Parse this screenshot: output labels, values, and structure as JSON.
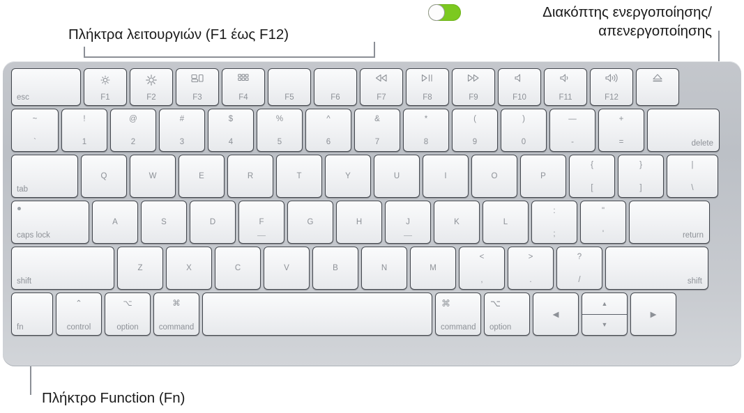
{
  "annotations": {
    "function_keys": "Πλήκτρα λειτουργιών (F1 έως F12)",
    "power_toggle": "Διακόπτης ενεργοποίησης/\nαπενεργοποίησης",
    "fn_key": "Πλήκτρο Function (Fn)"
  },
  "colors": {
    "toggle_on": "#7cc920",
    "toggle_knob": "#fdfdfd",
    "keyboard_body": "#c4c7cc",
    "key_face": "#f2f3f5",
    "key_legend": "#8d9197",
    "annotation_text": "#1a1a1a",
    "leader_line": "#8b8f96"
  },
  "keyboard": {
    "rows": [
      {
        "name": "function-row",
        "keys": [
          {
            "name": "esc",
            "label": "esc",
            "style": "bl"
          },
          {
            "name": "f1",
            "label": "F1",
            "style": "bc",
            "icon": "brightness-down-icon"
          },
          {
            "name": "f2",
            "label": "F2",
            "style": "bc",
            "icon": "brightness-up-icon"
          },
          {
            "name": "f3",
            "label": "F3",
            "style": "bc",
            "icon": "mission-control-icon"
          },
          {
            "name": "f4",
            "label": "F4",
            "style": "bc",
            "icon": "launchpad-icon"
          },
          {
            "name": "f5",
            "label": "F5",
            "style": "bc"
          },
          {
            "name": "f6",
            "label": "F6",
            "style": "bc"
          },
          {
            "name": "f7",
            "label": "F7",
            "style": "bc",
            "icon": "rewind-icon"
          },
          {
            "name": "f8",
            "label": "F8",
            "style": "bc",
            "icon": "play-pause-icon"
          },
          {
            "name": "f9",
            "label": "F9",
            "style": "bc",
            "icon": "fast-forward-icon"
          },
          {
            "name": "f10",
            "label": "F10",
            "style": "bc",
            "icon": "mute-icon"
          },
          {
            "name": "f11",
            "label": "F11",
            "style": "bc",
            "icon": "volume-down-icon"
          },
          {
            "name": "f12",
            "label": "F12",
            "style": "bc",
            "icon": "volume-up-icon"
          },
          {
            "name": "eject",
            "label": "",
            "style": "bc",
            "icon": "eject-icon"
          }
        ]
      },
      {
        "name": "number-row",
        "keys": [
          {
            "name": "grave-tilde",
            "upper": "~",
            "lower": "`"
          },
          {
            "name": "digit-1",
            "upper": "!",
            "lower": "1"
          },
          {
            "name": "digit-2",
            "upper": "@",
            "lower": "2"
          },
          {
            "name": "digit-3",
            "upper": "#",
            "lower": "3"
          },
          {
            "name": "digit-4",
            "upper": "$",
            "lower": "4"
          },
          {
            "name": "digit-5",
            "upper": "%",
            "lower": "5"
          },
          {
            "name": "digit-6",
            "upper": "^",
            "lower": "6"
          },
          {
            "name": "digit-7",
            "upper": "&",
            "lower": "7"
          },
          {
            "name": "digit-8",
            "upper": "*",
            "lower": "8"
          },
          {
            "name": "digit-9",
            "upper": "(",
            "lower": "9"
          },
          {
            "name": "digit-0",
            "upper": ")",
            "lower": "0"
          },
          {
            "name": "hyphen-underscore",
            "upper": "—",
            "lower": "-"
          },
          {
            "name": "equal-plus",
            "upper": "+",
            "lower": "="
          },
          {
            "name": "delete",
            "label": "delete",
            "style": "br"
          }
        ]
      },
      {
        "name": "qwerty-row",
        "keys": [
          {
            "name": "tab",
            "label": "tab",
            "style": "bl"
          },
          {
            "name": "letter-q",
            "label": "Q",
            "style": "c-mid"
          },
          {
            "name": "letter-w",
            "label": "W",
            "style": "c-mid"
          },
          {
            "name": "letter-e",
            "label": "E",
            "style": "c-mid"
          },
          {
            "name": "letter-r",
            "label": "R",
            "style": "c-mid"
          },
          {
            "name": "letter-t",
            "label": "T",
            "style": "c-mid"
          },
          {
            "name": "letter-y",
            "label": "Y",
            "style": "c-mid"
          },
          {
            "name": "letter-u",
            "label": "U",
            "style": "c-mid"
          },
          {
            "name": "letter-i",
            "label": "I",
            "style": "c-mid"
          },
          {
            "name": "letter-o",
            "label": "O",
            "style": "c-mid"
          },
          {
            "name": "letter-p",
            "label": "P",
            "style": "c-mid"
          },
          {
            "name": "bracket-left",
            "upper": "{",
            "lower": "["
          },
          {
            "name": "bracket-right",
            "upper": "}",
            "lower": "]"
          },
          {
            "name": "backslash-pipe",
            "upper": "|",
            "lower": "\\"
          }
        ]
      },
      {
        "name": "home-row",
        "keys": [
          {
            "name": "caps-lock",
            "label": "caps lock",
            "style": "bl",
            "indicator": true
          },
          {
            "name": "letter-a",
            "label": "A",
            "style": "c-mid"
          },
          {
            "name": "letter-s",
            "label": "S",
            "style": "c-mid"
          },
          {
            "name": "letter-d",
            "label": "D",
            "style": "c-mid"
          },
          {
            "name": "letter-f",
            "label": "F",
            "style": "c-mid",
            "homing": true
          },
          {
            "name": "letter-g",
            "label": "G",
            "style": "c-mid"
          },
          {
            "name": "letter-h",
            "label": "H",
            "style": "c-mid"
          },
          {
            "name": "letter-j",
            "label": "J",
            "style": "c-mid",
            "homing": true
          },
          {
            "name": "letter-k",
            "label": "K",
            "style": "c-mid"
          },
          {
            "name": "letter-l",
            "label": "L",
            "style": "c-mid"
          },
          {
            "name": "semicolon-colon",
            "upper": ":",
            "lower": ";"
          },
          {
            "name": "quote-doublequote",
            "upper": "\"",
            "lower": "'"
          },
          {
            "name": "return",
            "label": "return",
            "style": "br"
          }
        ]
      },
      {
        "name": "shift-row",
        "keys": [
          {
            "name": "shift-left",
            "label": "shift",
            "style": "bl"
          },
          {
            "name": "letter-z",
            "label": "Z",
            "style": "c-mid"
          },
          {
            "name": "letter-x",
            "label": "X",
            "style": "c-mid"
          },
          {
            "name": "letter-c",
            "label": "C",
            "style": "c-mid"
          },
          {
            "name": "letter-v",
            "label": "V",
            "style": "c-mid"
          },
          {
            "name": "letter-b",
            "label": "B",
            "style": "c-mid"
          },
          {
            "name": "letter-n",
            "label": "N",
            "style": "c-mid"
          },
          {
            "name": "letter-m",
            "label": "M",
            "style": "c-mid"
          },
          {
            "name": "comma-less",
            "upper": "<",
            "lower": ","
          },
          {
            "name": "period-greater",
            "upper": ">",
            "lower": "."
          },
          {
            "name": "slash-question",
            "upper": "?",
            "lower": "/"
          },
          {
            "name": "shift-right",
            "label": "shift",
            "style": "br"
          }
        ]
      },
      {
        "name": "modifier-row",
        "keys": [
          {
            "name": "fn",
            "label": "fn",
            "style": "bl"
          },
          {
            "name": "control-left",
            "label": "control",
            "style": "bc",
            "glyph": "⌃"
          },
          {
            "name": "option-left",
            "label": "option",
            "style": "bc",
            "glyph": "⌥"
          },
          {
            "name": "command-left",
            "label": "command",
            "style": "bc",
            "glyph": "⌘"
          },
          {
            "name": "space",
            "label": "",
            "style": "bc"
          },
          {
            "name": "command-right",
            "label": "command",
            "style": "bl",
            "glyph": "⌘",
            "glyph_align": "left"
          },
          {
            "name": "option-right",
            "label": "option",
            "style": "bl",
            "glyph": "⌥",
            "glyph_align": "left"
          },
          {
            "name": "arrow-left",
            "label": "◀",
            "style": "c-mid"
          },
          {
            "name": "arrow-up-down",
            "label": "",
            "split": true,
            "up": "▲",
            "down": "▼"
          },
          {
            "name": "arrow-right",
            "label": "▶",
            "style": "c-mid"
          }
        ]
      }
    ]
  }
}
